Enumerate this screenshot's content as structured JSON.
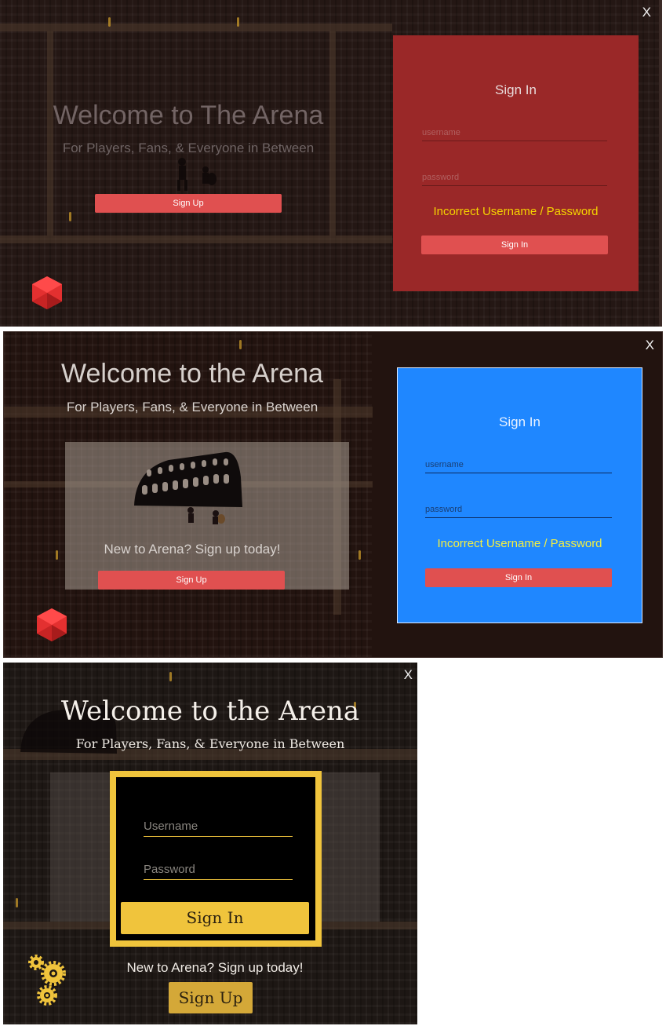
{
  "screens": [
    {
      "close_label": "X",
      "title": "Welcome to The Arena",
      "subtitle": "For Players, Fans, & Everyone in Between",
      "signup_button": "Sign Up",
      "signin": {
        "title": "Sign In",
        "username_placeholder": "username",
        "password_placeholder": "password",
        "error": "Incorrect Username / Password",
        "button": "Sign In"
      },
      "logo_icon": "red-hexagon-icon",
      "colors": {
        "panel": "#9a2828",
        "button": "#e05050",
        "error": "#f5d400"
      }
    },
    {
      "close_label": "X",
      "title": "Welcome to the Arena",
      "subtitle": "For Players, Fans, & Everyone in Between",
      "signup_prompt": "New to Arena?  Sign up today!",
      "signup_button": "Sign Up",
      "signin": {
        "title": "Sign In",
        "username_placeholder": "username",
        "password_placeholder": "password",
        "error": "Incorrect Username / Password",
        "button": "Sign In"
      },
      "logo_icon": "red-hexagon-icon",
      "colors": {
        "panel": "#1f87ff",
        "button": "#e05050",
        "error": "#f5f040"
      }
    },
    {
      "close_label": "X",
      "title": "Welcome to the Arena",
      "subtitle": "For Players, Fans, & Everyone in Between",
      "signin": {
        "username_placeholder": "Username",
        "password_placeholder": "Password",
        "button": "Sign In"
      },
      "signup_prompt": "New to Arena?  Sign up today!",
      "signup_button": "Sign Up",
      "logo_icon": "gears-icon",
      "colors": {
        "frame": "#f0c43c",
        "panel": "#000000",
        "button": "#f0c43c"
      }
    }
  ]
}
